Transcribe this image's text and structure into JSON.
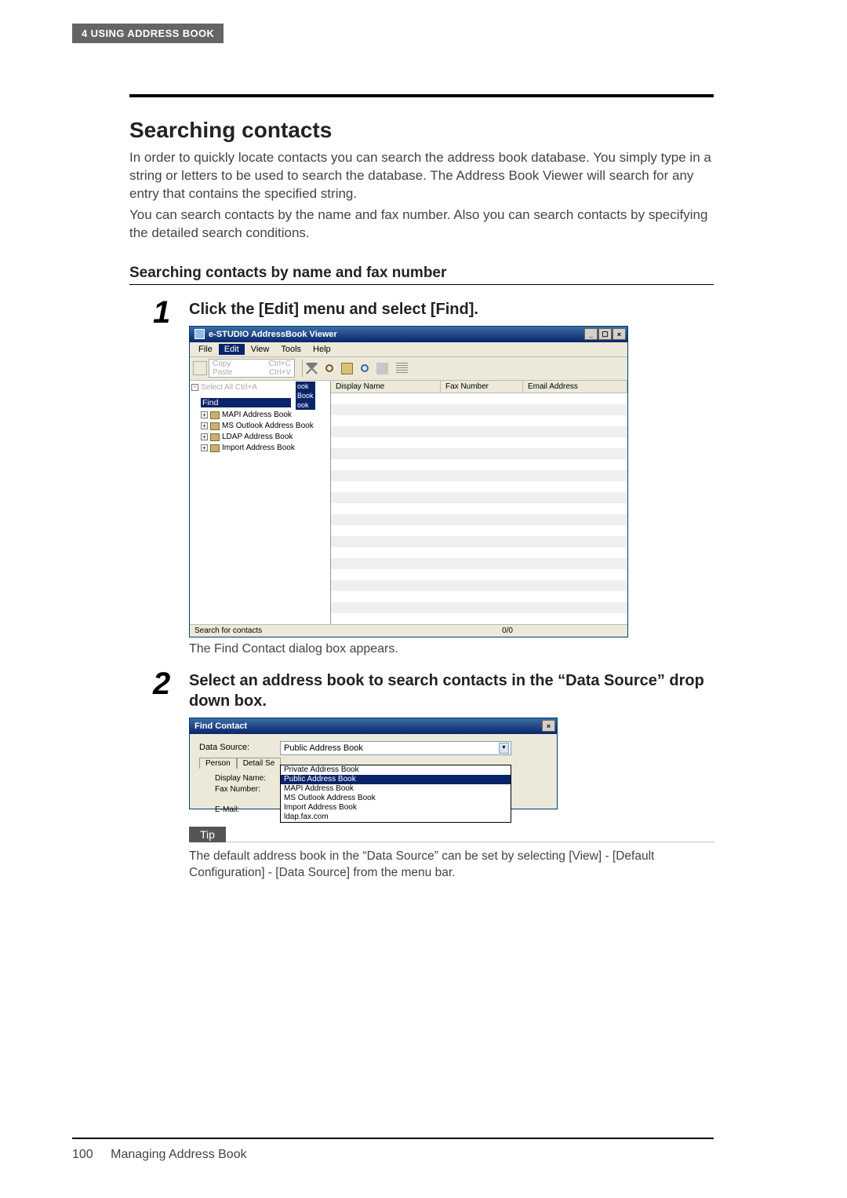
{
  "header": {
    "chapter": "4  USING ADDRESS BOOK"
  },
  "section": {
    "title": "Searching contacts",
    "intro_p1": "In order to quickly locate contacts you can search the address book database. You simply type in a string or letters to be used to search the database. The Address Book Viewer will search for any entry that contains the specified string.",
    "intro_p2": "You can search contacts by the name and fax number. Also you can search contacts by specifying the detailed search conditions.",
    "subhead": "Searching contacts by name and fax number"
  },
  "step1": {
    "num": "1",
    "title": "Click the [Edit] menu and select [Find].",
    "caption": "The Find Contact dialog box appears."
  },
  "step2": {
    "num": "2",
    "title": "Select an address book to search contacts in the “Data Source” drop down box."
  },
  "app_window": {
    "title": "e-STUDIO AddressBook Viewer",
    "menu": {
      "file": "File",
      "edit": "Edit",
      "view": "View",
      "tools": "Tools",
      "help": "Help"
    },
    "edit_menu": {
      "copy": "Copy",
      "copy_sc": "Ctrl+C",
      "paste": "Paste",
      "paste_sc": "Ctrl+V",
      "selectall": "Select All  Ctrl+A",
      "find": "Find"
    },
    "tree_suffixes": [
      "ook",
      "Book",
      "ook"
    ],
    "tree_items": [
      "MAPI Address Book",
      "MS Outlook Address Book",
      "LDAP Address Book",
      "Import Address Book"
    ],
    "columns": {
      "display_name": "Display Name",
      "fax_number": "Fax Number",
      "email": "Email Address"
    },
    "status_left": "Search for contacts",
    "status_right": "0/0"
  },
  "find_dialog": {
    "title": "Find Contact",
    "data_source_label": "Data Source:",
    "selected": "Public Address Book",
    "options": [
      "Private Address Book",
      "Public Address Book",
      "MAPI Address Book",
      "MS Outlook Address Book",
      "Import Address Book",
      "ldap.fax.com"
    ],
    "tabs": {
      "person": "Person",
      "detail": "Detail Se"
    },
    "labels": {
      "display_name": "Display Name:",
      "fax_number": "Fax Number:",
      "email": "E-Mail:"
    }
  },
  "tip": {
    "label": "Tip",
    "text": "The default address book in the “Data Source” can be set by selecting [View] - [Default Configuration] - [Data Source] from the menu bar."
  },
  "footer": {
    "page": "100",
    "title": "Managing Address Book"
  }
}
